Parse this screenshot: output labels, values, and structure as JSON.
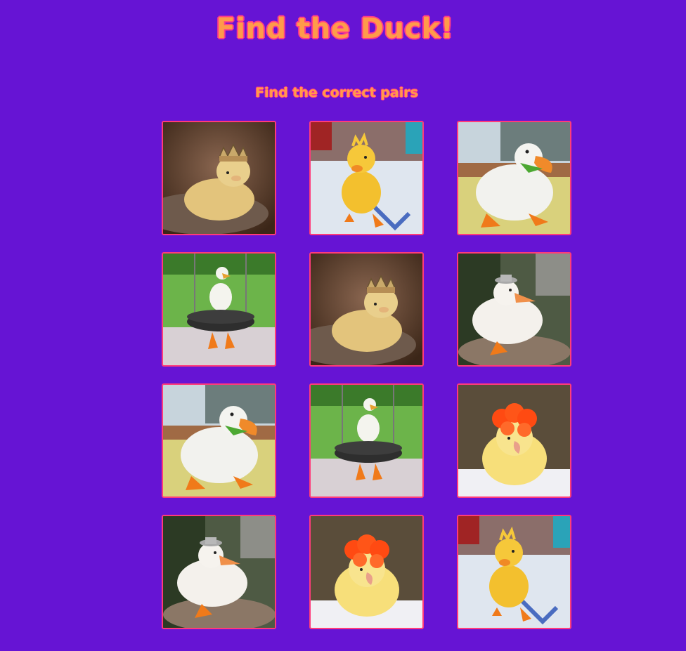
{
  "game": {
    "title": "Find the Duck!",
    "subtitle": "Find the correct pairs"
  },
  "colors": {
    "background": "#6614d4",
    "title_fill": "#ff9b4a",
    "title_outline": "#ff3b8a",
    "card_border": "#ff3b7a"
  },
  "cards": [
    {
      "image": "duckling-crown"
    },
    {
      "image": "duckling-standing"
    },
    {
      "image": "white-duck-lettuce"
    },
    {
      "image": "duck-tire-swing"
    },
    {
      "image": "duckling-crown"
    },
    {
      "image": "white-duck-hat"
    },
    {
      "image": "white-duck-lettuce"
    },
    {
      "image": "duck-tire-swing"
    },
    {
      "image": "duckling-flower-hat"
    },
    {
      "image": "white-duck-hat"
    },
    {
      "image": "duckling-flower-hat"
    },
    {
      "image": "duckling-standing"
    }
  ]
}
